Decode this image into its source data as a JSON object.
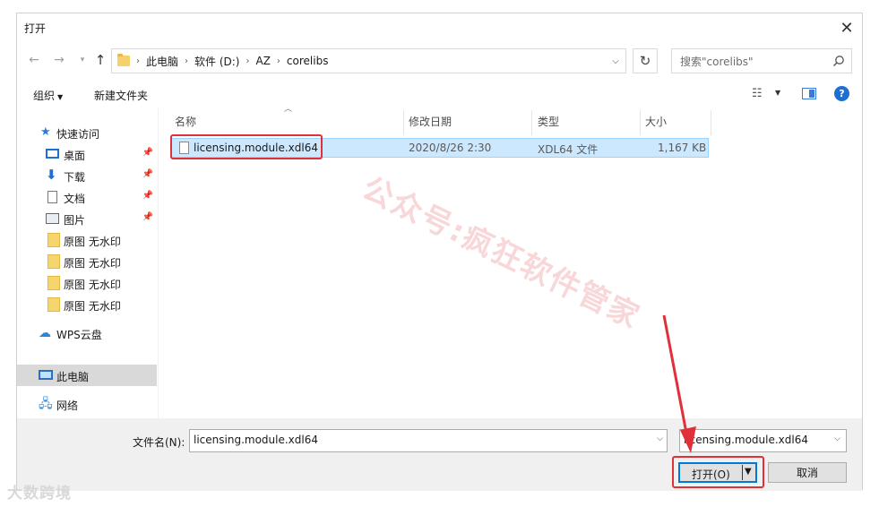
{
  "window": {
    "title": "打开",
    "close_glyph": "✕"
  },
  "address": {
    "breadcrumb": [
      "此电脑",
      "软件 (D:)",
      "AZ",
      "corelibs"
    ],
    "search_placeholder": "搜索\"corelibs\""
  },
  "toolbar": {
    "organize": "组织",
    "new_folder": "新建文件夹"
  },
  "nav": {
    "quick_access": "快速访问",
    "items": [
      {
        "label": "桌面",
        "icon": "desktop-icon",
        "pinned": true
      },
      {
        "label": "下载",
        "icon": "download-icon",
        "pinned": true
      },
      {
        "label": "文档",
        "icon": "document-icon",
        "pinned": true
      },
      {
        "label": "图片",
        "icon": "pictures-icon",
        "pinned": true
      },
      {
        "label": "原图 无水印",
        "icon": "folder-icon",
        "pinned": false
      },
      {
        "label": "原图 无水印",
        "icon": "folder-icon",
        "pinned": false
      },
      {
        "label": "原图 无水印",
        "icon": "folder-icon",
        "pinned": false
      },
      {
        "label": "原图 无水印",
        "icon": "folder-icon",
        "pinned": false
      }
    ],
    "wps_cloud": "WPS云盘",
    "this_pc": "此电脑",
    "network": "网络"
  },
  "files": {
    "columns": [
      "名称",
      "修改日期",
      "类型",
      "大小"
    ],
    "rows": [
      {
        "name": "licensing.module.xdl64",
        "modified": "2020/8/26 2:30",
        "type": "XDL64 文件",
        "size": "1,167 KB",
        "selected": true
      }
    ]
  },
  "footer": {
    "filename_label": "文件名(N):",
    "filename_value": "licensing.module.xdl64",
    "filetype_value": "licensing.module.xdl64",
    "open_label": "打开(O)",
    "cancel_label": "取消"
  },
  "overlay": {
    "watermark": "公众号:疯狂软件管家",
    "brand": "大数跨境"
  },
  "colors": {
    "highlight": "#e0303a",
    "selection": "#cce8ff",
    "accent": "#0078d7"
  }
}
